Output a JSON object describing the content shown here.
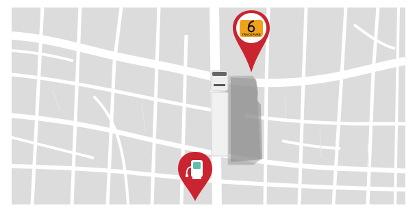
{
  "map": {
    "colors": {
      "block": "#dcdcdc",
      "road": "#ffffff",
      "pin_red": "#c9242f",
      "brand_orange": "#f0a21c",
      "fuel_teal": "#5fbfae",
      "truck": "#e9e9e9",
      "shadow": "#9a9a9a"
    },
    "markers": [
      {
        "type": "brand-pin",
        "icon": "trackpure-logo-icon",
        "logo_text": "TRACKPURE"
      },
      {
        "type": "fuel-pin",
        "icon": "fuel-pump-icon"
      }
    ],
    "vehicle": {
      "type": "truck",
      "icon": "truck-icon"
    }
  }
}
